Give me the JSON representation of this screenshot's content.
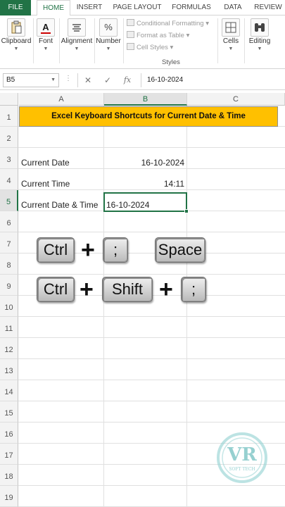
{
  "ribbon_tabs": [
    "FILE",
    "HOME",
    "INSERT",
    "PAGE LAYOUT",
    "FORMULAS",
    "DATA",
    "REVIEW"
  ],
  "ribbon": {
    "clipboard": "Clipboard",
    "font": "Font",
    "alignment": "Alignment",
    "number": "Number",
    "conditional_formatting": "Conditional Formatting",
    "format_as_table": "Format as Table",
    "cell_styles": "Cell Styles",
    "styles_group": "Styles",
    "cells": "Cells",
    "editing": "Editing",
    "number_icon": "%",
    "font_icon": "A"
  },
  "formula_bar": {
    "name_box": "B5",
    "cancel_glyph": "✕",
    "enter_glyph": "✓",
    "fx_glyph": "fx",
    "content": "16-10-2024"
  },
  "columns": [
    "A",
    "B",
    "C"
  ],
  "rows": [
    "1",
    "2",
    "3",
    "4",
    "5",
    "6",
    "7",
    "8",
    "9",
    "10",
    "11",
    "12",
    "13",
    "14",
    "15",
    "16",
    "17",
    "18",
    "19"
  ],
  "sheet": {
    "title": "Excel Keyboard Shortcuts for Current Date & Time",
    "a3": "Current Date",
    "b3": "16-10-2024",
    "a4": "Current Time",
    "b4": "14:11",
    "a5": "Current Date & Time",
    "b5": "16-10-2024"
  },
  "shortcuts": {
    "row1": {
      "k1": "Ctrl",
      "plus": "+",
      "k2": ";",
      "k3": "Space"
    },
    "row2": {
      "k1": "Ctrl",
      "plus1": "+",
      "k2": "Shift",
      "plus2": "+",
      "k3": ";"
    }
  },
  "watermark": {
    "letters": "VR",
    "text": "SOFT TECH"
  },
  "colors": {
    "accent": "#217346",
    "title_fill": "#ffc000",
    "watermark": "#5fb8b8"
  }
}
